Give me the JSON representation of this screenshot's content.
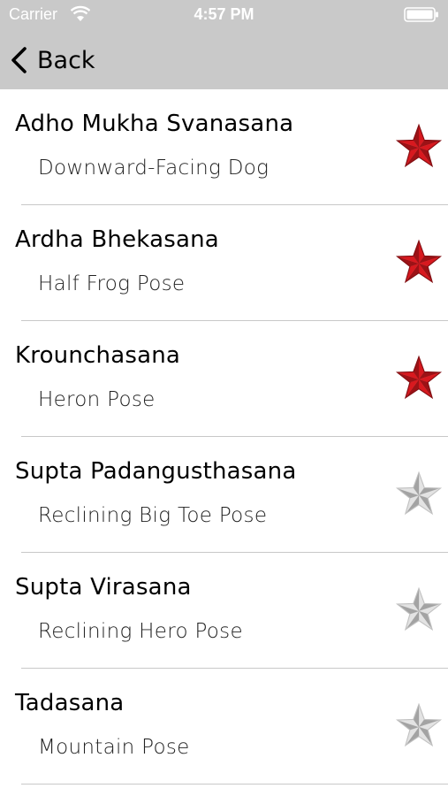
{
  "status_bar": {
    "carrier": "Carrier",
    "time": "4:57 PM"
  },
  "nav": {
    "back_label": "Back"
  },
  "colors": {
    "header_bg": "#c9c9c9",
    "star_active": "#d8191f",
    "star_inactive": "#e3e3e3"
  },
  "poses": [
    {
      "sanskrit": "Adho Mukha Svanasana",
      "english": "Downward-Facing Dog",
      "favorite": true
    },
    {
      "sanskrit": "Ardha Bhekasana",
      "english": "Half Frog Pose",
      "favorite": true
    },
    {
      "sanskrit": "Krounchasana",
      "english": "Heron Pose",
      "favorite": true
    },
    {
      "sanskrit": "Supta Padangusthasana",
      "english": "Reclining Big Toe Pose",
      "favorite": false
    },
    {
      "sanskrit": "Supta Virasana",
      "english": "Reclining Hero Pose",
      "favorite": false
    },
    {
      "sanskrit": "Tadasana",
      "english": "Mountain Pose",
      "favorite": false
    }
  ]
}
